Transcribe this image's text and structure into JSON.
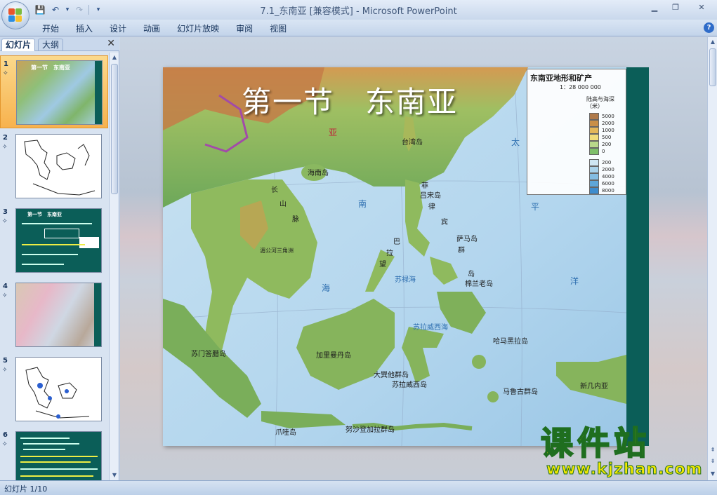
{
  "window": {
    "filename": "7.1_东南亚",
    "mode": "[兼容模式]",
    "separator": "-",
    "app": "Microsoft PowerPoint"
  },
  "qat": {
    "save": "💾",
    "undo": "↶",
    "redo": "↷",
    "more": "▾"
  },
  "tabs": [
    "开始",
    "插入",
    "设计",
    "动画",
    "幻灯片放映",
    "审阅",
    "视图"
  ],
  "help": "?",
  "left_panel": {
    "tab_slides": "幻灯片",
    "tab_outline": "大纲",
    "close": "✕"
  },
  "thumbnails": [
    {
      "num": "1",
      "anim": "✧",
      "style": "map",
      "caption": "第一节　东南亚"
    },
    {
      "num": "2",
      "anim": "✧",
      "style": "outline"
    },
    {
      "num": "3",
      "anim": "✧",
      "style": "green",
      "caption": "第一节　东南亚"
    },
    {
      "num": "4",
      "anim": "✧",
      "style": "map2"
    },
    {
      "num": "5",
      "anim": "✧",
      "style": "outline2"
    },
    {
      "num": "6",
      "anim": "✧",
      "style": "green2"
    }
  ],
  "slide": {
    "title": "第一节　东南亚",
    "legend_title": "东南亚地形和矿产",
    "legend_scale": "1：28 000 000",
    "legend_head": "陆高与海深（米）",
    "legend_land": [
      {
        "label": "5000",
        "color": "#b07a4a"
      },
      {
        "label": "2000",
        "color": "#c98f48"
      },
      {
        "label": "1000",
        "color": "#e3b75a"
      },
      {
        "label": "500",
        "color": "#f0dc7a"
      },
      {
        "label": "200",
        "color": "#b9d98a"
      },
      {
        "label": "0",
        "color": "#7fbf6a"
      }
    ],
    "legend_sea": [
      {
        "label": "200",
        "color": "#cfe6f3"
      },
      {
        "label": "2000",
        "color": "#a9d2ea"
      },
      {
        "label": "4000",
        "color": "#84bde2"
      },
      {
        "label": "6000",
        "color": "#5ea6d8"
      },
      {
        "label": "8000",
        "color": "#3e8ccd"
      }
    ],
    "labels": {
      "ya": "亚",
      "taiwan": "台湾岛",
      "hainan": "海南岛",
      "luzon": "吕宋岛",
      "samar": "萨马岛",
      "mindanao": "棉兰老岛",
      "borneo": "加里曼丹岛",
      "sulawesi": "苏拉威西岛",
      "newguinea": "新几内亚",
      "halmahera": "哈马黑拉岛",
      "chang": "长",
      "shan": "山",
      "mai": "脉",
      "fei": "菲",
      "lv": "律",
      "bin": "宾",
      "qun": "群",
      "dao": "岛",
      "tai": "太",
      "ping": "平",
      "nan": "南",
      "hai": "海",
      "yang": "洋",
      "sumatra": "苏门答腊岛",
      "java": "爪哇岛",
      "dasunda": "大巽他群岛",
      "xiaosunda": "努沙登加拉群岛",
      "bali": "巴",
      "la": "拉",
      "wang": "望",
      "sulu": "苏禄海",
      "meigong": "湄公河三角洲",
      "sulawesi_sea": "苏拉威西海",
      "moluccas": "马鲁古群岛"
    }
  },
  "watermark": {
    "top": "课件站",
    "bottom": "www.kjzhan.com"
  },
  "status": {
    "text": "幻灯片 1/10"
  }
}
